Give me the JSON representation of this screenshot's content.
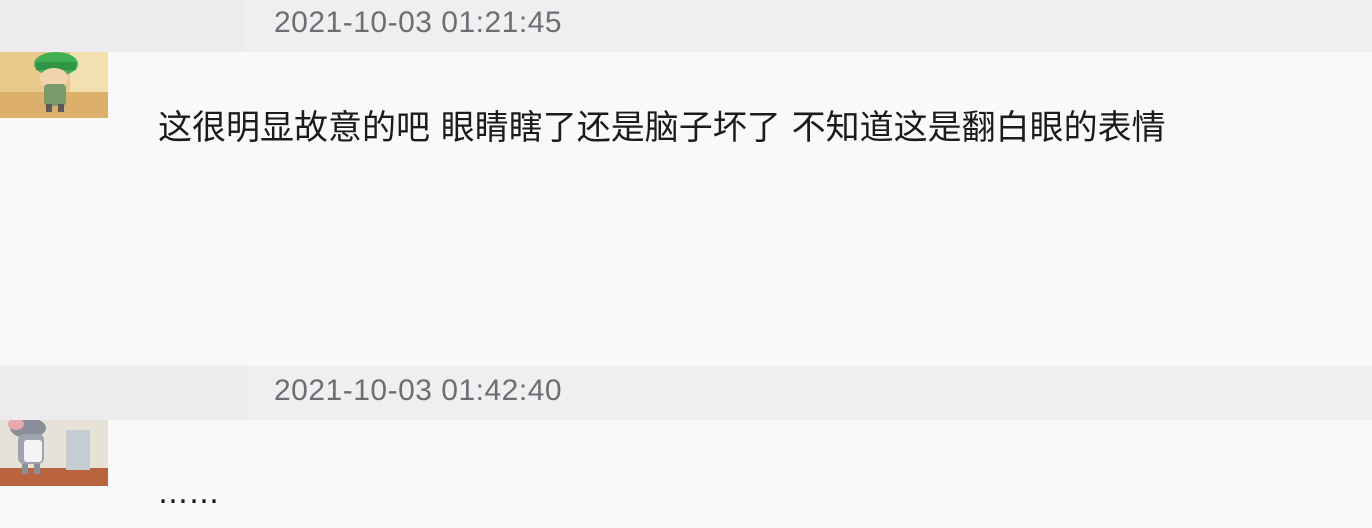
{
  "comments": [
    {
      "timestamp": "2021-10-03 01:21:45",
      "text": "这很明显故意的吧 眼睛瞎了还是脑子坏了 不知道这是翻白眼的表情",
      "avatar_icon": "cartoon-character-green-hat-avatar-icon"
    },
    {
      "timestamp": "2021-10-03 01:42:40",
      "text": "……",
      "avatar_icon": "cartoon-cat-avatar-icon"
    }
  ]
}
